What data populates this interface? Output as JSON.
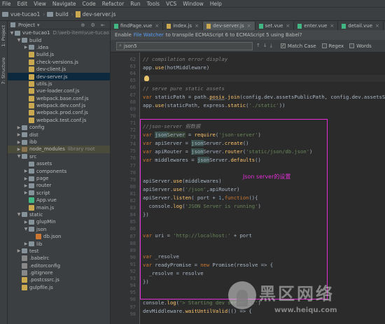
{
  "menu": [
    "File",
    "Edit",
    "View",
    "Navigate",
    "Code",
    "Refactor",
    "Run",
    "Tools",
    "VCS",
    "Window",
    "Help"
  ],
  "breadcrumbs": [
    "vue-tucao1",
    "build",
    "dev-server.js"
  ],
  "tabs": [
    {
      "label": "findPage.vue",
      "type": "vue",
      "active": false
    },
    {
      "label": "index.js",
      "type": "js",
      "active": false
    },
    {
      "label": "dev-server.js",
      "type": "js",
      "active": true
    },
    {
      "label": "set.vue",
      "type": "vue",
      "active": false
    },
    {
      "label": "enter.vue",
      "type": "vue",
      "active": false
    },
    {
      "label": "detail.vue",
      "type": "vue",
      "active": false
    }
  ],
  "sidebar": {
    "project_label": "Project",
    "left_tabs": [
      "1: Project",
      "7: Structure"
    ],
    "tree": [
      {
        "label": "vue-tucao1",
        "note": "D:\\web-item\\vue-tucao1",
        "depth": 0,
        "arrow": "▼",
        "icon": "dir"
      },
      {
        "label": "build",
        "depth": 1,
        "arrow": "▼",
        "icon": "dir"
      },
      {
        "label": ".idea",
        "depth": 2,
        "arrow": "▶",
        "icon": "dir"
      },
      {
        "label": "build.js",
        "depth": 2,
        "icon": "js"
      },
      {
        "label": "check-versions.js",
        "depth": 2,
        "icon": "js"
      },
      {
        "label": "dev-client.js",
        "depth": 2,
        "icon": "js"
      },
      {
        "label": "dev-server.js",
        "depth": 2,
        "icon": "js",
        "selected": true
      },
      {
        "label": "utils.js",
        "depth": 2,
        "icon": "js"
      },
      {
        "label": "vue-loader.conf.js",
        "depth": 2,
        "icon": "js"
      },
      {
        "label": "webpack.base.conf.js",
        "depth": 2,
        "icon": "js"
      },
      {
        "label": "webpack.dev.conf.js",
        "depth": 2,
        "icon": "js"
      },
      {
        "label": "webpack.prod.conf.js",
        "depth": 2,
        "icon": "js"
      },
      {
        "label": "webpack.test.conf.js",
        "depth": 2,
        "icon": "js"
      },
      {
        "label": "config",
        "depth": 1,
        "arrow": "▶",
        "icon": "dir"
      },
      {
        "label": "dist",
        "depth": 1,
        "arrow": "▶",
        "icon": "dir"
      },
      {
        "label": "ibb",
        "depth": 1,
        "arrow": "▶",
        "icon": "dir"
      },
      {
        "label": "node_modules",
        "note": "library root",
        "depth": 1,
        "arrow": "▶",
        "icon": "dirx",
        "highlight": true
      },
      {
        "label": "src",
        "depth": 1,
        "arrow": "▼",
        "icon": "dir"
      },
      {
        "label": "assets",
        "depth": 2,
        "arrow": "",
        "icon": "dir"
      },
      {
        "label": "components",
        "depth": 2,
        "arrow": "▶",
        "icon": "dir"
      },
      {
        "label": "page",
        "depth": 2,
        "arrow": "▶",
        "icon": "dir"
      },
      {
        "label": "router",
        "depth": 2,
        "arrow": "▶",
        "icon": "dir"
      },
      {
        "label": "script",
        "depth": 2,
        "arrow": "▶",
        "icon": "dir"
      },
      {
        "label": "App.vue",
        "depth": 2,
        "icon": "vue"
      },
      {
        "label": "main.js",
        "depth": 2,
        "icon": "js"
      },
      {
        "label": "static",
        "depth": 1,
        "arrow": "▼",
        "icon": "dir"
      },
      {
        "label": "glupMin",
        "depth": 2,
        "arrow": "▶",
        "icon": "dir"
      },
      {
        "label": "json",
        "depth": 2,
        "arrow": "▼",
        "icon": "dir"
      },
      {
        "label": "db.json",
        "depth": 3,
        "icon": "json"
      },
      {
        "label": "lib",
        "depth": 2,
        "arrow": "▶",
        "icon": "dir"
      },
      {
        "label": "test",
        "depth": 1,
        "arrow": "▶",
        "icon": "dir"
      },
      {
        "label": ".babelrc",
        "depth": 1,
        "icon": "cfg"
      },
      {
        "label": ".editorconfig",
        "depth": 1,
        "icon": "cfg"
      },
      {
        "label": ".gitignore",
        "depth": 1,
        "icon": "cfg"
      },
      {
        "label": ".postcssrc.js",
        "depth": 1,
        "icon": "js"
      },
      {
        "label": "gulpfile.js",
        "depth": 1,
        "icon": "js"
      }
    ]
  },
  "notice": {
    "prefix": "Enable",
    "link": "File Watcher",
    "suffix": "to transpile ECMAScript 6 to ECMAScript 5 using Babel?"
  },
  "search": {
    "query": "json5",
    "options": [
      {
        "label": "Match Case",
        "checked": true
      },
      {
        "label": "Regex",
        "checked": false
      },
      {
        "label": "Words",
        "checked": false
      }
    ]
  },
  "editor": {
    "line_numbers": [
      "62",
      "63",
      "64",
      "65",
      "66",
      "67",
      "68",
      "69",
      "70",
      "71",
      "72",
      "73",
      "74",
      "75",
      "76",
      "77",
      "78",
      "79",
      "80",
      "81",
      "82",
      "83",
      "84",
      "85",
      "86",
      "87",
      "88",
      "89",
      "90",
      "91",
      "92",
      "93",
      "94",
      "95",
      "96",
      "97",
      "98"
    ]
  },
  "annotation": "Json server的设置",
  "watermark": {
    "text": "黑区网络",
    "url": "www.heiqu.com"
  },
  "colors": {
    "highlight_box": "#e42fd8",
    "keyword": "#cc7832",
    "string": "#6a8759",
    "comment": "#808080"
  }
}
